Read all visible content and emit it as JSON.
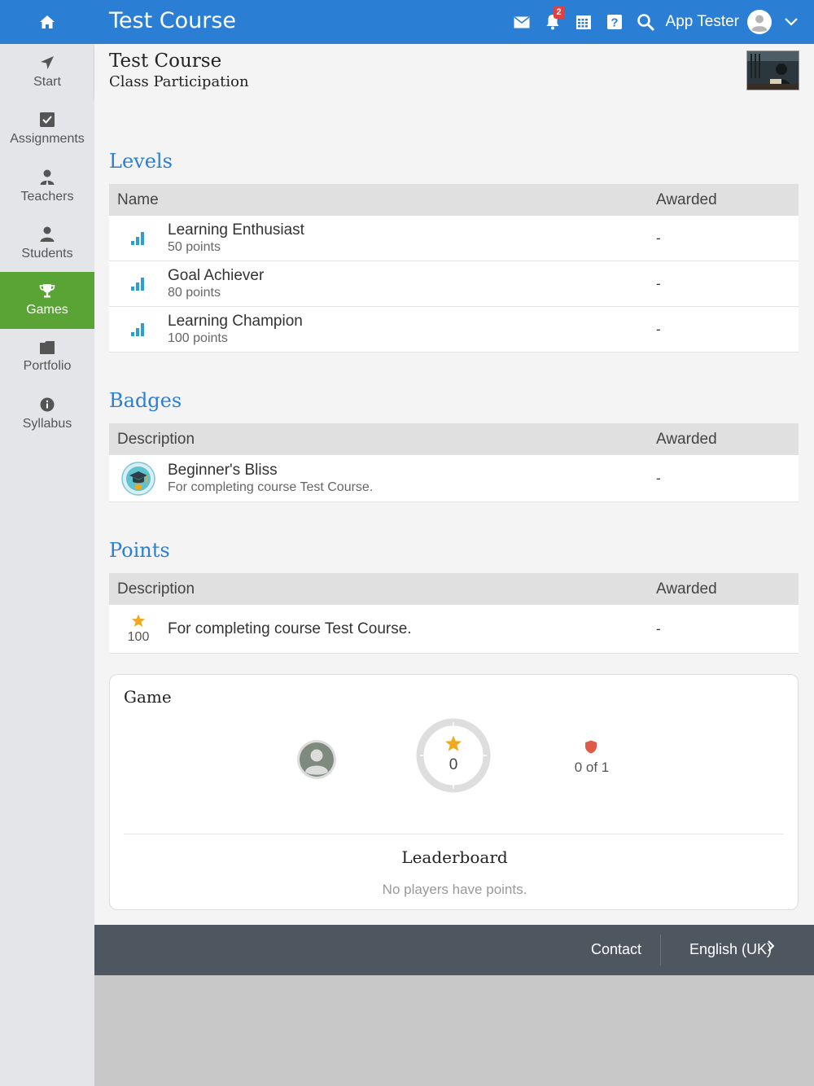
{
  "topbar": {
    "title": "Test Course",
    "notification_count": "2",
    "user_name": "App Tester"
  },
  "sidebar": {
    "items": [
      {
        "label": "Start"
      },
      {
        "label": "Assignments"
      },
      {
        "label": "Teachers"
      },
      {
        "label": "Students"
      },
      {
        "label": "Games"
      },
      {
        "label": "Portfolio"
      },
      {
        "label": "Syllabus"
      }
    ],
    "active": "Games"
  },
  "header": {
    "title": "Test Course",
    "subtitle": "Class Participation"
  },
  "levels": {
    "heading": "Levels",
    "col_name": "Name",
    "col_awarded": "Awarded",
    "rows": [
      {
        "name": "Learning Enthusiast",
        "points": "50 points",
        "awarded": "-"
      },
      {
        "name": "Goal Achiever",
        "points": "80 points",
        "awarded": "-"
      },
      {
        "name": "Learning Champion",
        "points": "100 points",
        "awarded": "-"
      }
    ]
  },
  "badges": {
    "heading": "Badges",
    "col_desc": "Description",
    "col_awarded": "Awarded",
    "rows": [
      {
        "name": "Beginner's Bliss",
        "desc": "For completing course Test Course.",
        "awarded": "-"
      }
    ]
  },
  "points": {
    "heading": "Points",
    "col_desc": "Description",
    "col_awarded": "Awarded",
    "rows": [
      {
        "value": "100",
        "desc": "For completing course Test Course.",
        "awarded": "-"
      }
    ]
  },
  "game": {
    "title": "Game",
    "points": "0",
    "badges_progress": "0 of 1",
    "leaderboard_title": "Leaderboard",
    "leaderboard_empty": "No players have points."
  },
  "footer": {
    "contact": "Contact",
    "language": "English (UK)"
  },
  "colors": {
    "topbar": "#2a7fd4",
    "active_nav": "#5aa436",
    "section_heading": "#2a7fd4",
    "footer": "#4e5660",
    "star": "#f2a81d",
    "shield": "#e05a48"
  }
}
